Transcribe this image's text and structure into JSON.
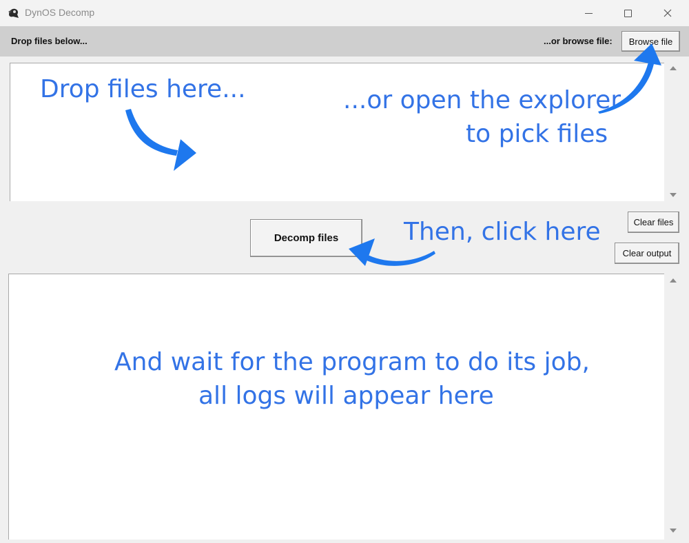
{
  "window": {
    "title": "DynOS Decomp",
    "controls": [
      "minimize-icon",
      "maximize-icon",
      "close-icon"
    ]
  },
  "toolbar": {
    "drop_label": "Drop files below...",
    "browse_label": "...or browse file:",
    "browse_button": "Browse file"
  },
  "actions": {
    "decomp_button": "Decomp files",
    "clear_files_button": "Clear files",
    "clear_output_button": "Clear output"
  },
  "annotations": {
    "drop_hint": "Drop files here...",
    "explorer_hint_line1": "...or open the explorer",
    "explorer_hint_line2": "to pick files",
    "click_hint": "Then, click here",
    "wait_hint_line1": "And wait for the program to do its job,",
    "wait_hint_line2": "all logs will appear here"
  },
  "colors": {
    "annotation": "#3373e6",
    "arrow": "#1e78ee",
    "toolbar_bg": "#cfcfcf",
    "window_bg": "#f0f0f0"
  }
}
